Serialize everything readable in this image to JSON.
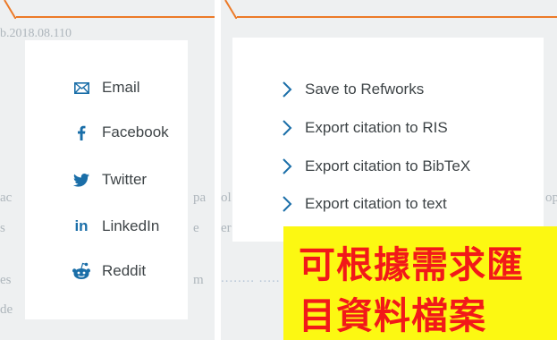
{
  "left_panel": {
    "bg_date": "b.2018.08.110"
  },
  "share_menu": {
    "items": [
      {
        "label": "Email",
        "icon": "envelope-icon"
      },
      {
        "label": "Facebook",
        "icon": "facebook-icon"
      },
      {
        "label": "Twitter",
        "icon": "twitter-icon"
      },
      {
        "label": "LinkedIn",
        "icon": "linkedin-icon"
      },
      {
        "label": "Reddit",
        "icon": "reddit-icon"
      }
    ]
  },
  "export_menu": {
    "items": [
      {
        "label": "Save to Refworks",
        "icon": "chevron-right-icon"
      },
      {
        "label": "Export citation to RIS",
        "icon": "chevron-right-icon"
      },
      {
        "label": "Export citation to BibTeX",
        "icon": "chevron-right-icon"
      },
      {
        "label": "Export citation to text",
        "icon": "chevron-right-icon"
      }
    ]
  },
  "annotation": {
    "line1": "可根據需求匯",
    "line2": "目資料檔案"
  },
  "colors": {
    "accent_orange": "#ec7a28",
    "icon_blue": "#1a6ea8",
    "annotation_bg": "#fcf812",
    "annotation_text": "#f21919"
  }
}
